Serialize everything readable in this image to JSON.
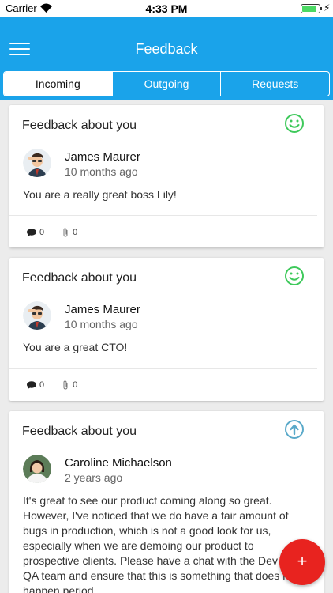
{
  "status_bar": {
    "carrier": "Carrier",
    "time": "4:33 PM",
    "bolt": "⚡"
  },
  "nav": {
    "title": "Feedback"
  },
  "tabs": [
    {
      "label": "Incoming",
      "active": true
    },
    {
      "label": "Outgoing",
      "active": false
    },
    {
      "label": "Requests",
      "active": false
    }
  ],
  "feedback_items": [
    {
      "title": "Feedback about you",
      "mood_icon": "smiley-icon",
      "author": "James Maurer",
      "time_ago": "10 months ago",
      "text": "You are a really great boss Lily!",
      "comments": "0",
      "attachments": "0"
    },
    {
      "title": "Feedback about you",
      "mood_icon": "smiley-icon",
      "author": "James Maurer",
      "time_ago": "10 months ago",
      "text": "You are a great CTO!",
      "comments": "0",
      "attachments": "0"
    },
    {
      "title": "Feedback about you",
      "mood_icon": "arrow-up-circle-icon",
      "author": "Caroline Michaelson",
      "time_ago": "2 years ago",
      "text": "It's great to see our product coming along so great. However, I've noticed that we do have a fair amount of bugs in production, which is not a good look for us, especially when we are demoing our product to prospective clients. Please have a chat with the Dev and QA team and ensure that this is something that does not happen period."
    }
  ],
  "fab": {
    "label": "+"
  },
  "colors": {
    "header": "#1aa3ea",
    "smiley": "#3ec95b",
    "arrow_icon": "#5aa9c9",
    "fab": "#e8231f"
  }
}
